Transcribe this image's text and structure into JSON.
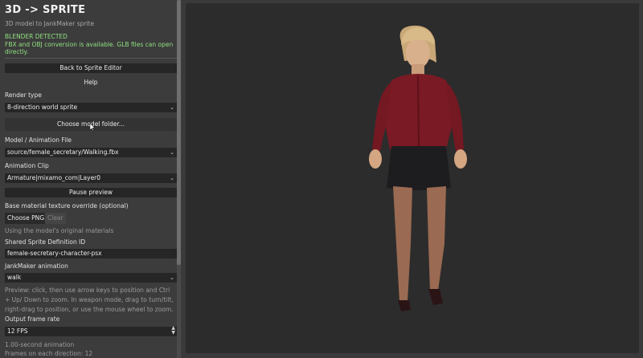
{
  "app": {
    "title": "3D  ->  SPRITE",
    "subtitle": "3D model to JankMaker sprite",
    "status_title": "BLENDER DETECTED",
    "status_detail": "FBX and OBJ conversion is available. GLB files can open directly."
  },
  "buttons": {
    "back": "Back to Sprite Editor",
    "help": "Help",
    "choose_model_folder": "Choose model folder...",
    "pause_preview": "Pause preview",
    "choose_png": "Choose PNG...",
    "clear": "Clear"
  },
  "render_type": {
    "label": "Render type",
    "value": "8-direction world sprite"
  },
  "model_file": {
    "label": "Model / Animation File",
    "value": "source/female_secretary/Walking.fbx"
  },
  "animation_clip": {
    "label": "Animation Clip",
    "value": "Armature|mixamo_com|Layer0"
  },
  "texture_override": {
    "label": "Base material texture override (optional)",
    "hint": "Using the model's original materials"
  },
  "sprite_def": {
    "label": "Shared Sprite Definition ID",
    "value": "female-secretary-character-psx"
  },
  "jank_animation": {
    "label": "JankMaker animation",
    "value": "walk"
  },
  "preview_hint": "Preview: click, then use arrow keys to position and Ctrl + Up/ Down to zoom. In weapon mode, drag to turn/tilt, right-drag to position, or use the mouse wheel to zoom.",
  "frame_rate": {
    "label": "Output frame rate",
    "value": "12  FPS"
  },
  "animation_length": "1.00-second animation",
  "frames_per_direction": "Frames on each direction: 12",
  "colors": {
    "accent_green": "#8fe07f",
    "panel_bg": "#3c3c3c",
    "viewport_bg": "#2c2c2c"
  },
  "icons": {
    "dropdown": "chevron-down-icon",
    "spinner": "up-down-stepper-icon",
    "cursor": "mouse-pointer-icon"
  }
}
